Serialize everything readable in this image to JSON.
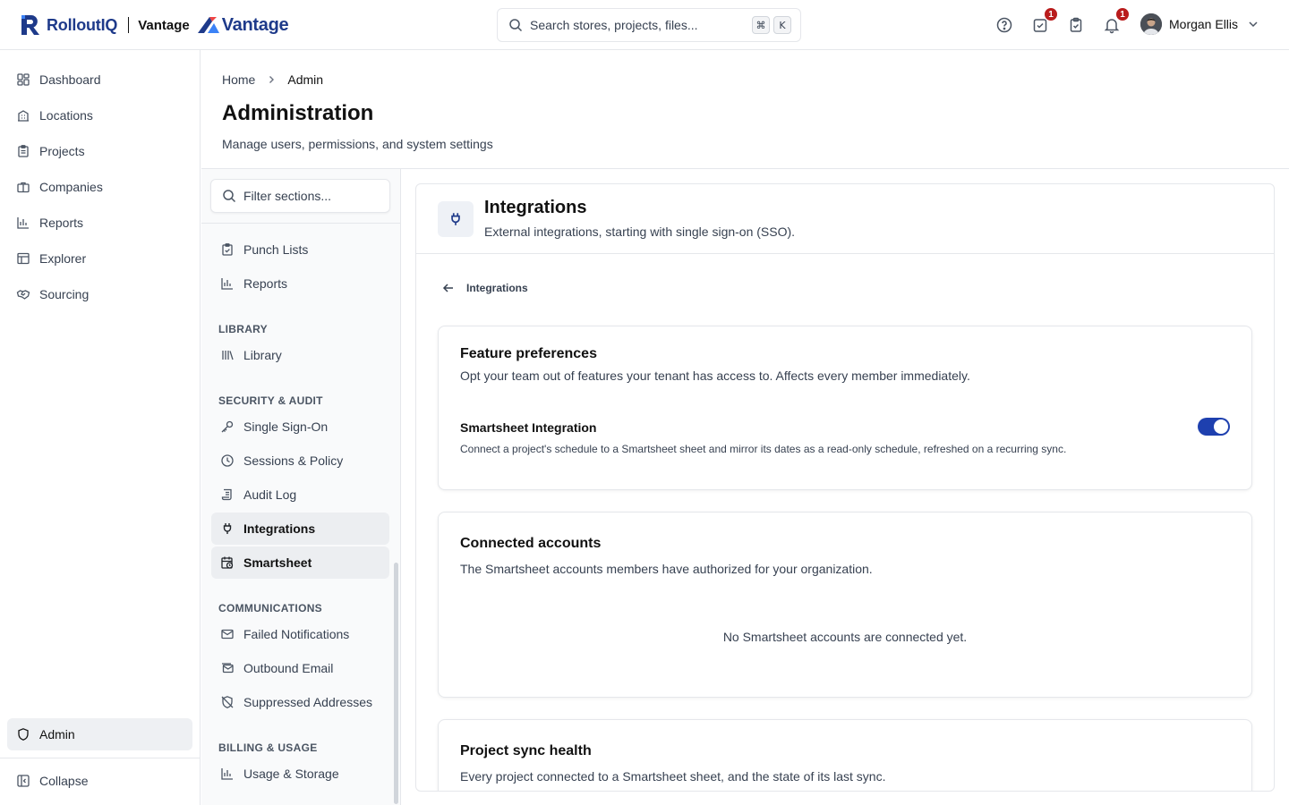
{
  "brand": {
    "name": "RolloutIQ",
    "workspace": "Vantage",
    "partner_logo_text": "Vantage"
  },
  "search": {
    "placeholder": "Search stores, projects, files...",
    "shortcut_mod": "⌘",
    "shortcut_key": "K"
  },
  "topbar": {
    "tasks_badge": "1",
    "notifications_badge": "1",
    "user_name": "Morgan Ellis"
  },
  "leftnav": {
    "items": [
      {
        "label": "Dashboard",
        "icon": "dashboard-icon"
      },
      {
        "label": "Locations",
        "icon": "building-icon"
      },
      {
        "label": "Projects",
        "icon": "clipboard-icon"
      },
      {
        "label": "Companies",
        "icon": "briefcase-icon"
      },
      {
        "label": "Reports",
        "icon": "bar-chart-icon"
      },
      {
        "label": "Explorer",
        "icon": "table-icon"
      },
      {
        "label": "Sourcing",
        "icon": "handshake-icon"
      }
    ],
    "admin": "Admin",
    "collapse": "Collapse"
  },
  "breadcrumb": {
    "home": "Home",
    "current": "Admin"
  },
  "page": {
    "title": "Administration",
    "subtitle": "Manage users, permissions, and system settings"
  },
  "sections": {
    "filter_placeholder": "Filter sections...",
    "top_items": [
      "Punch Lists",
      "Reports"
    ],
    "groups": [
      {
        "heading": "LIBRARY",
        "items": [
          "Library"
        ]
      },
      {
        "heading": "SECURITY & AUDIT",
        "items": [
          "Single Sign-On",
          "Sessions & Policy",
          "Audit Log",
          "Integrations",
          "Smartsheet"
        ]
      },
      {
        "heading": "COMMUNICATIONS",
        "items": [
          "Failed Notifications",
          "Outbound Email",
          "Suppressed Addresses"
        ]
      },
      {
        "heading": "BILLING & USAGE",
        "items": [
          "Usage & Storage"
        ]
      }
    ]
  },
  "panel": {
    "title": "Integrations",
    "subtitle": "External integrations, starting with single sign-on (SSO).",
    "back_label": "Integrations"
  },
  "feature_prefs": {
    "title": "Feature preferences",
    "description": "Opt your team out of features your tenant has access to. Affects every member immediately.",
    "feature_name": "Smartsheet Integration",
    "feature_description": "Connect a project's schedule to a Smartsheet sheet and mirror its dates as a read-only schedule, refreshed on a recurring sync.",
    "enabled": true
  },
  "connected_accounts": {
    "title": "Connected accounts",
    "description": "The Smartsheet accounts members have authorized for your organization.",
    "empty": "No Smartsheet accounts are connected yet."
  },
  "sync_health": {
    "title": "Project sync health",
    "description": "Every project connected to a Smartsheet sheet, and the state of its last sync."
  },
  "colors": {
    "brand": "#1e3a8a",
    "toggle_on": "#1e40af",
    "badge": "#b91c1c"
  }
}
